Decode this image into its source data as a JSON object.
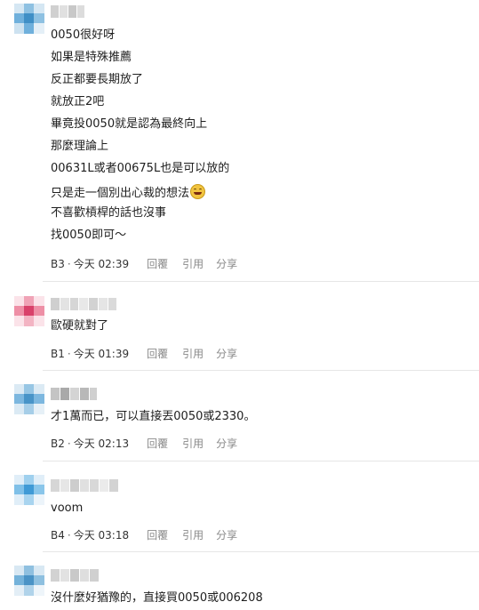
{
  "comments": [
    {
      "floor": "B3",
      "time": "今天 02:39",
      "lines": [
        "0050很好呀",
        "如果是特殊推薦",
        "反正都要長期放了",
        "就放正2吧",
        "畢竟投0050就是認為最終向上",
        "那麼理論上",
        "00631L或者00675L也是可以放的",
        "只是走一個別出心裁的想法",
        "不喜歡槓桿的話也沒事",
        "找0050即可～"
      ],
      "emoji_icon": "grinning-face-icon"
    },
    {
      "floor": "B1",
      "time": "今天 01:39",
      "lines": [
        "歐硬就對了"
      ]
    },
    {
      "floor": "B2",
      "time": "今天 02:13",
      "lines": [
        "才1萬而已，可以直接丟0050或2330。"
      ]
    },
    {
      "floor": "B4",
      "time": "今天 03:18",
      "lines": [
        "voom"
      ]
    },
    {
      "floor": "",
      "time": "",
      "lines": [
        "沒什麼好猶豫的，直接買0050或006208"
      ]
    }
  ],
  "actions": {
    "reply": "回覆",
    "quote": "引用",
    "share": "分享"
  },
  "separator": "·",
  "colors": {
    "meta_action": "#8a8a8a",
    "divider": "#e6e6e6",
    "avatar_blue": "#4a9ed0",
    "avatar_pink": "#e0607e"
  }
}
